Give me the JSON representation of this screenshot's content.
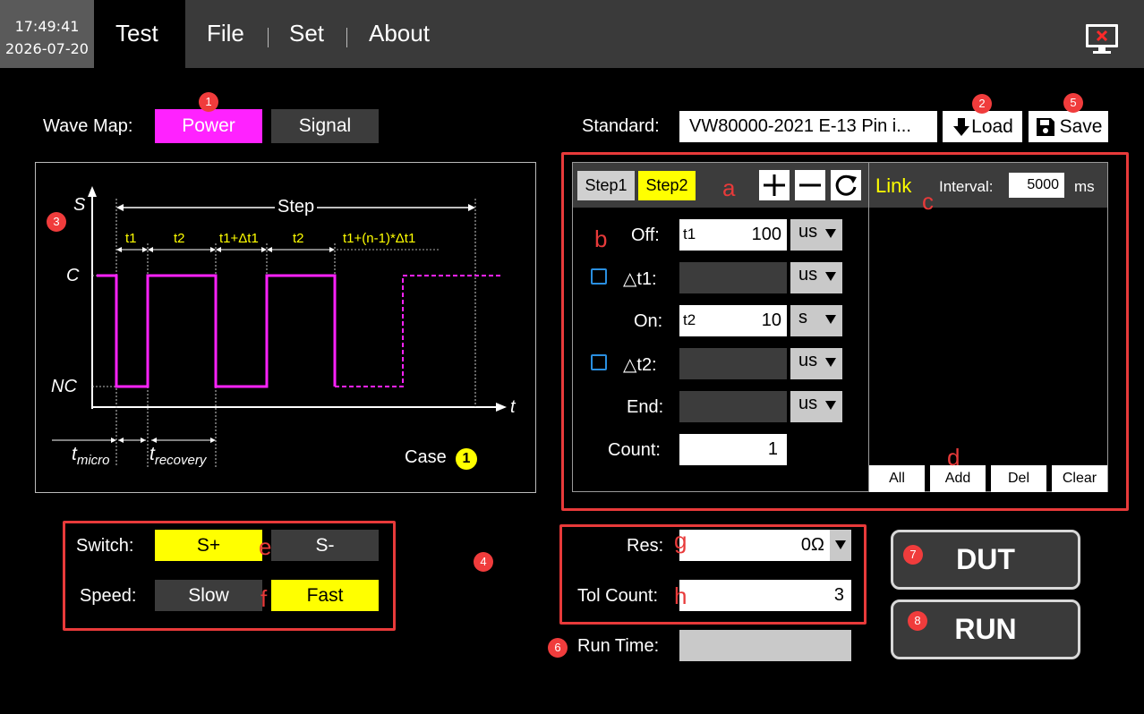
{
  "header": {
    "time": "17:49:41",
    "date": "2026-07-20",
    "tabs": [
      "Test",
      "File",
      "Set",
      "About"
    ],
    "active_tab": "Test",
    "exit_icon": "monitor-close-icon"
  },
  "wave_map": {
    "label": "Wave Map:",
    "power_label": "Power",
    "signal_label": "Signal",
    "selected": "Power"
  },
  "standard": {
    "label": "Standard:",
    "value": "VW80000-2021 E-13 Pin i...",
    "load_label": "Load",
    "save_label": "Save"
  },
  "diagram": {
    "y_axis": "S",
    "x_axis": "t",
    "level_high": "C",
    "level_low": "NC",
    "step_label": "Step",
    "segments": [
      "t1",
      "t2",
      "t1+Δt1",
      "t2",
      "t1+(n-1)*Δt1"
    ],
    "t_micro": "micro",
    "t_recovery": "recovery",
    "t_prefix": "t",
    "case_label": "Case",
    "case_number": "1"
  },
  "steps": {
    "step1_label": "Step1",
    "step2_label": "Step2",
    "active": "Step2"
  },
  "params": {
    "off_label": "Off:",
    "off_sub": "t1",
    "off_value": "100",
    "off_unit": "us",
    "dt1_label": "△t1:",
    "dt1_unit": "us",
    "on_label": "On:",
    "on_sub": "t2",
    "on_value": "10",
    "on_unit": "s",
    "dt2_label": "△t2:",
    "dt2_unit": "us",
    "end_label": "End:",
    "end_unit": "us",
    "count_label": "Count:",
    "count_value": "1"
  },
  "link": {
    "title": "Link",
    "interval_label": "Interval:",
    "interval_value": "5000",
    "interval_unit": "ms",
    "buttons": [
      "All",
      "Add",
      "Del",
      "Clear"
    ]
  },
  "switch_panel": {
    "switch_label": "Switch:",
    "s_plus": "S+",
    "s_minus": "S-",
    "speed_label": "Speed:",
    "slow": "Slow",
    "fast": "Fast"
  },
  "res_panel": {
    "res_label": "Res:",
    "res_value": "0Ω",
    "tol_label": "Tol Count:",
    "tol_value": "3",
    "runtime_label": "Run Time:",
    "runtime_value": ""
  },
  "actions": {
    "dut_label": "DUT",
    "run_label": "RUN"
  },
  "annotations": {
    "badges": [
      "1",
      "2",
      "5",
      "3",
      "4",
      "6",
      "7",
      "8"
    ],
    "letters": [
      "a",
      "b",
      "c",
      "d",
      "e",
      "f",
      "g",
      "h"
    ]
  },
  "colors": {
    "accent_magenta": "#ff22ff",
    "accent_yellow": "#ffff00",
    "annotation_red": "#e83a3a"
  }
}
